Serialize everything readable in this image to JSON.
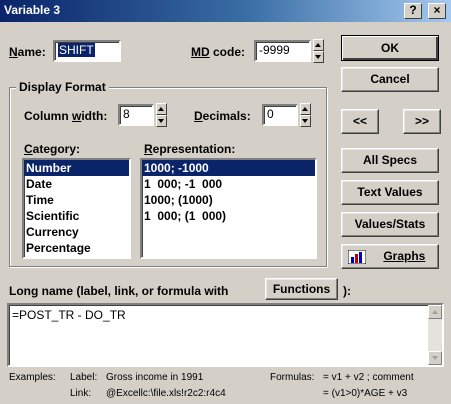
{
  "window": {
    "title": "Variable 3",
    "help_label": "?",
    "close_label": "×"
  },
  "name": {
    "label_prefix": "N",
    "label_rest": "ame:",
    "value": "SHIFT"
  },
  "md_code": {
    "label_prefix": "MD",
    "label_rest": " code:",
    "value": "-9999"
  },
  "display_format": {
    "title": "Display Format",
    "column_width": {
      "label_a": "Column ",
      "label_u": "w",
      "label_b": "idth:",
      "value": "8"
    },
    "decimals": {
      "label_u": "D",
      "label_rest": "ecimals:",
      "value": "0"
    },
    "category": {
      "label_u": "C",
      "label_rest": "ategory:",
      "items": [
        "Number",
        "Date",
        "Time",
        "Scientific",
        "Currency",
        "Percentage"
      ],
      "selected": "Number"
    },
    "representation": {
      "label_u": "R",
      "label_rest": "epresentation:",
      "items": [
        "1000; -1000",
        "1  000; -1  000",
        "1000; (1000)",
        "1  000; (1  000)"
      ],
      "selected": "1000; -1000"
    }
  },
  "buttons": {
    "ok": "OK",
    "cancel": "Cancel",
    "prev": "<<",
    "next": ">>",
    "all_specs": "All Specs",
    "text_values": "Text Values",
    "values_stats": "Values/Stats",
    "graphs": "Graphs",
    "functions": "Functions"
  },
  "long_name": {
    "label": "Long name (label, link, or formula with",
    "label_end": "):",
    "value": "=POST_TR - DO_TR"
  },
  "examples": {
    "title": "Examples:",
    "label_key": "Label:",
    "label_value": "Gross income in 1991",
    "link_key": "Link:",
    "link_value": "@Excellc:\\file.xls!r2c2:r4c4",
    "formulas_key": "Formulas:",
    "formula_1": "= v1 + v2 ; comment",
    "formula_2": "= (v1>0)*AGE + v3"
  },
  "colors": {
    "selection": "#0a246a",
    "face": "#d4d0c8",
    "title_start": "#0a246a"
  },
  "icons": {
    "graphs": "bar-chart-icon"
  }
}
